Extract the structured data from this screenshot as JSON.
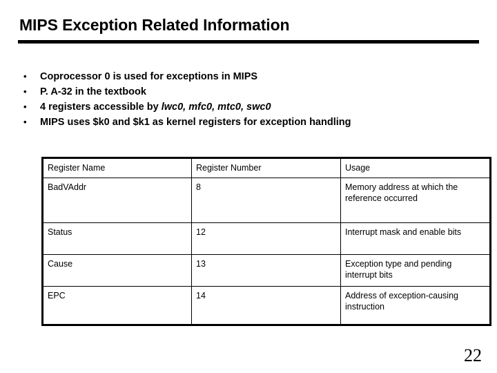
{
  "slide": {
    "title": "MIPS Exception Related Information",
    "page_number": "22"
  },
  "bullets": {
    "marker": "•",
    "items": [
      {
        "parts": [
          {
            "text": "Coprocessor 0 is used for exceptions in MIPS",
            "italic": false
          }
        ]
      },
      {
        "parts": [
          {
            "text": "P. A-32 in the textbook",
            "italic": false
          }
        ]
      },
      {
        "parts": [
          {
            "text": "4 registers accessible by ",
            "italic": false
          },
          {
            "text": "lwc0, mfc0, mtc0, swc0",
            "italic": true
          }
        ]
      },
      {
        "parts": [
          {
            "text": "MIPS uses $k0 and $k1 as kernel registers for exception handling",
            "italic": false
          }
        ]
      }
    ]
  },
  "table": {
    "headers": [
      "Register Name",
      "Register Number",
      "Usage"
    ],
    "rows": [
      {
        "name": "BadVAddr",
        "number": "8",
        "usage": "Memory address at which the reference occurred"
      },
      {
        "name": "Status",
        "number": "12",
        "usage": "Interrupt mask and enable bits"
      },
      {
        "name": "Cause",
        "number": "13",
        "usage": "Exception type and pending interrupt bits"
      },
      {
        "name": "EPC",
        "number": "14",
        "usage": "Address of exception-causing instruction"
      }
    ]
  },
  "colors": {
    "background": "#ffffff",
    "text": "#000000",
    "rule": "#000000"
  }
}
